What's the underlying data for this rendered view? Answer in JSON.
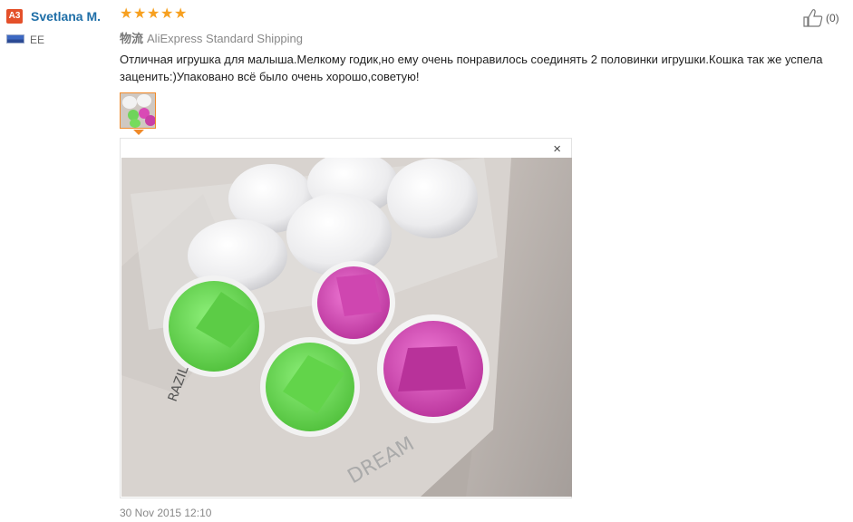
{
  "reviewer": {
    "level_badge": "A3",
    "name": "Svetlana M.",
    "country": "EE",
    "flag_icon": "flag-estonia-icon"
  },
  "rating": {
    "stars": 5,
    "max": 5,
    "color": "#f7a01f"
  },
  "helpful": {
    "icon": "thumbs-up-icon",
    "count": "(0)"
  },
  "shipping": {
    "label_chinese": "物流",
    "method": "AliExpress Standard Shipping"
  },
  "review": {
    "text": "Отличная игрушка для малыша.Мелкому годик,но ему очень понравилось соединять 2 половинки игрушки.Кошка так же успела заценить:)Упаковано всё было очень хорошо,советую!",
    "date": "30 Nov 2015 12:10"
  },
  "viewer": {
    "close_label": "×"
  },
  "colors": {
    "name_link": "#1e6ea7",
    "badge": "#e4502a",
    "thumb_border": "#f08a2a"
  }
}
